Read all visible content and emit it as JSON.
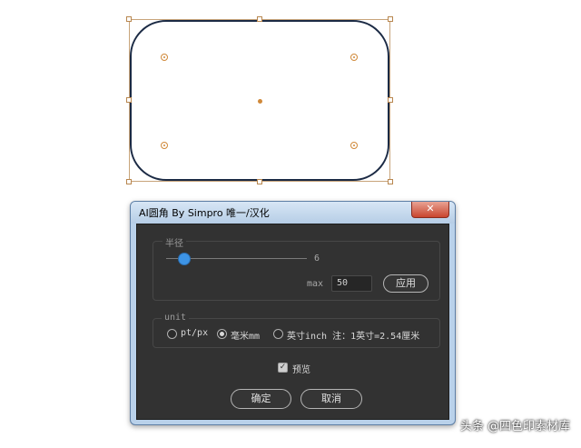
{
  "dialog": {
    "title": "AI圆角 By Simpro 唯一/汉化",
    "close_icon": "close-x-icon",
    "close_glyph": "✕",
    "radius_group": {
      "label": "半径",
      "slider_value": "6",
      "slider_fraction": 0.13,
      "max_label": "max",
      "max_value": "50",
      "apply_label": "应用"
    },
    "unit_group": {
      "label": "unit",
      "options": [
        {
          "label": "pt/px",
          "selected": false
        },
        {
          "label": "毫米mm",
          "selected": true
        },
        {
          "label": "英寸inch 注：1英寸=2.54厘米",
          "selected": false
        }
      ]
    },
    "preview": {
      "label": "预览",
      "checked": true
    },
    "ok_label": "确定",
    "cancel_label": "取消"
  },
  "watermark": "头条 @四色印素材库",
  "colors": {
    "shape_stroke": "#1b2a44",
    "selection": "#c8a47a",
    "slider_accent": "#3d94e6",
    "panel_bg": "#323232"
  }
}
